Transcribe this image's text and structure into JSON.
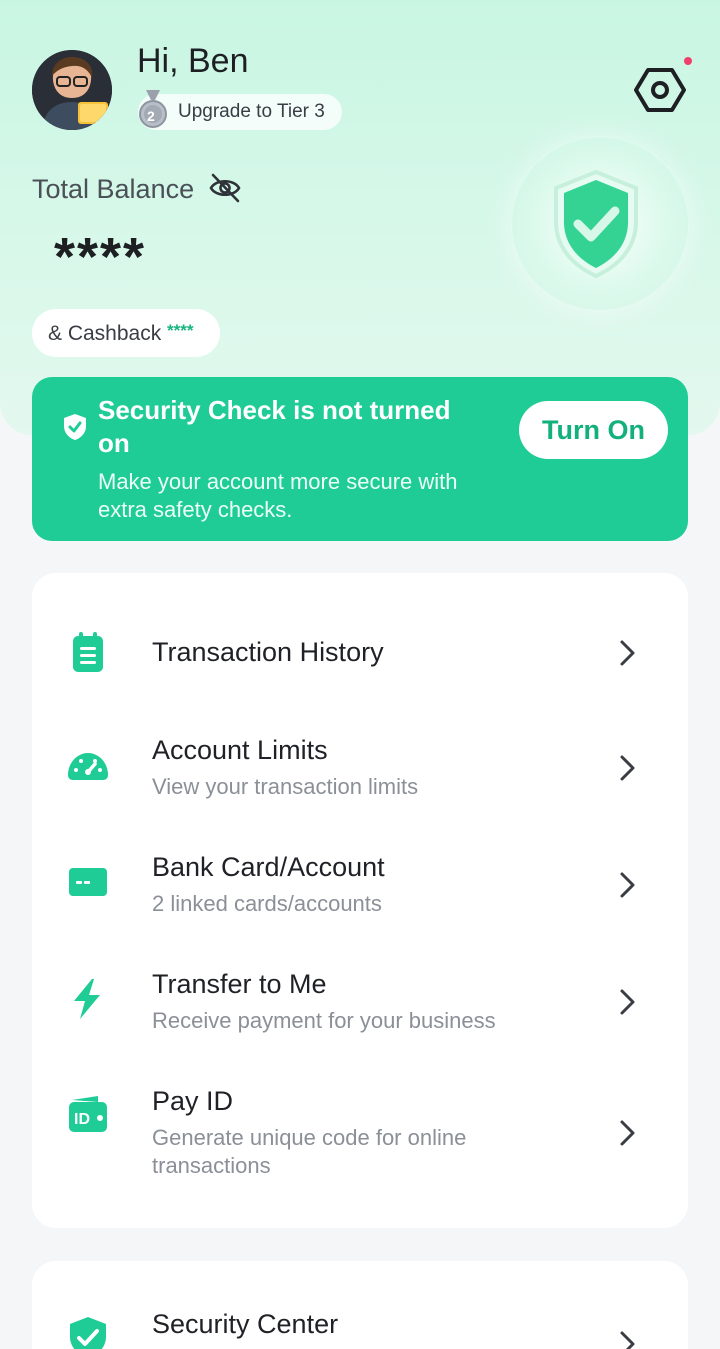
{
  "header": {
    "greeting": "Hi, Ben",
    "tier_label": "Upgrade to Tier 3",
    "tier_level": "2",
    "settings_icon": "hexagon-gear-icon",
    "has_notification": true
  },
  "balance": {
    "label": "Total Balance",
    "value": "****",
    "visibility_icon": "eye-off-icon",
    "cashback_label": "& Cashback",
    "cashback_value": "****"
  },
  "security_banner": {
    "title": "Security Check is not turned on",
    "description": "Make your account more secure with extra safety checks.",
    "button_label": "Turn On"
  },
  "menu": {
    "items": [
      {
        "title": "Transaction History",
        "subtitle": "",
        "icon": "clipboard-icon"
      },
      {
        "title": "Account Limits",
        "subtitle": "View your transaction limits",
        "icon": "speedometer-icon"
      },
      {
        "title": "Bank Card/Account",
        "subtitle": "2 linked cards/accounts",
        "icon": "card-icon"
      },
      {
        "title": "Transfer to Me",
        "subtitle": "Receive payment for your business",
        "icon": "lightning-icon"
      },
      {
        "title": "Pay ID",
        "subtitle": "Generate unique code for online transactions",
        "icon": "id-wallet-icon"
      }
    ]
  },
  "menu2": {
    "items": [
      {
        "title": "Security Center",
        "icon": "shield-check-icon"
      }
    ]
  },
  "colors": {
    "accent": "#1fcc95",
    "accent_dark": "#12b07c",
    "hero_bg": "#c9f6e3",
    "notification": "#f0406b"
  }
}
